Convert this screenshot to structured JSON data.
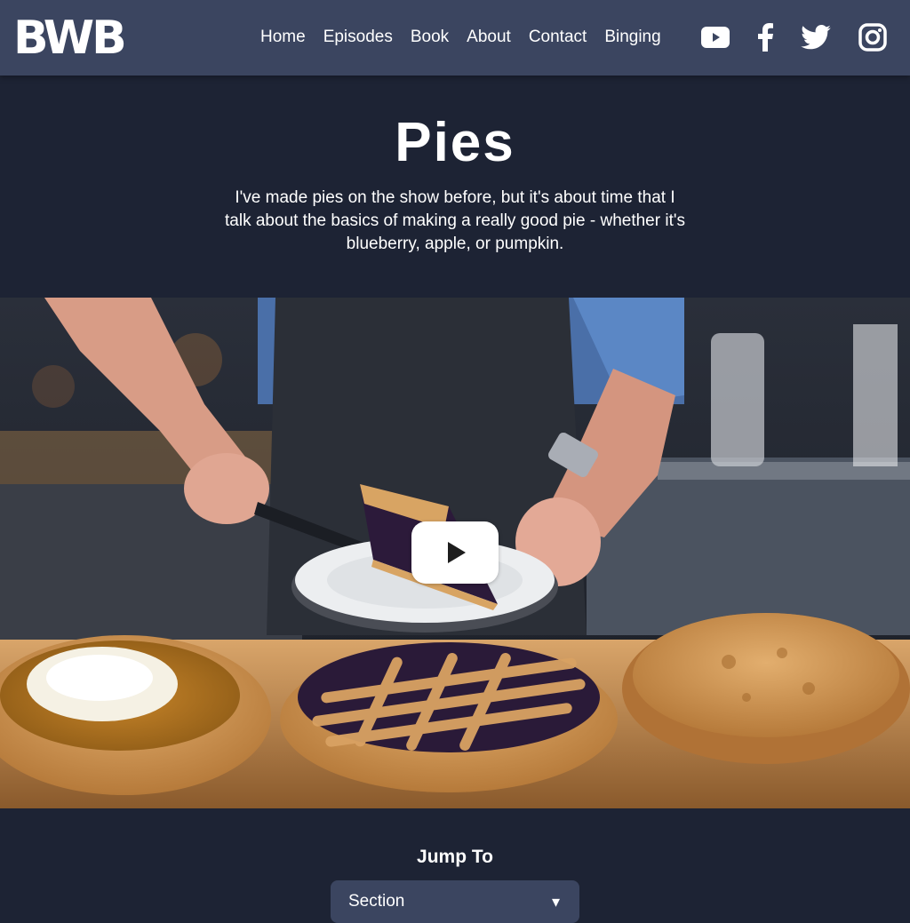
{
  "nav": {
    "logo": "BWB",
    "links": [
      "Home",
      "Episodes",
      "Book",
      "About",
      "Contact",
      "Binging"
    ],
    "social": [
      "youtube-icon",
      "facebook-icon",
      "twitter-icon",
      "instagram-icon"
    ]
  },
  "hero": {
    "title": "Pies",
    "intro": "I've made pies on the show before, but it's about time that I talk about the basics of making a really good pie - whether it's blueberry, apple, or pumpkin."
  },
  "video": {
    "play_icon": "play-icon"
  },
  "jump": {
    "title": "Jump To",
    "select_value": "Section"
  },
  "colors": {
    "navbar": "#3b4560",
    "background": "#1d2334",
    "text": "#ffffff"
  }
}
